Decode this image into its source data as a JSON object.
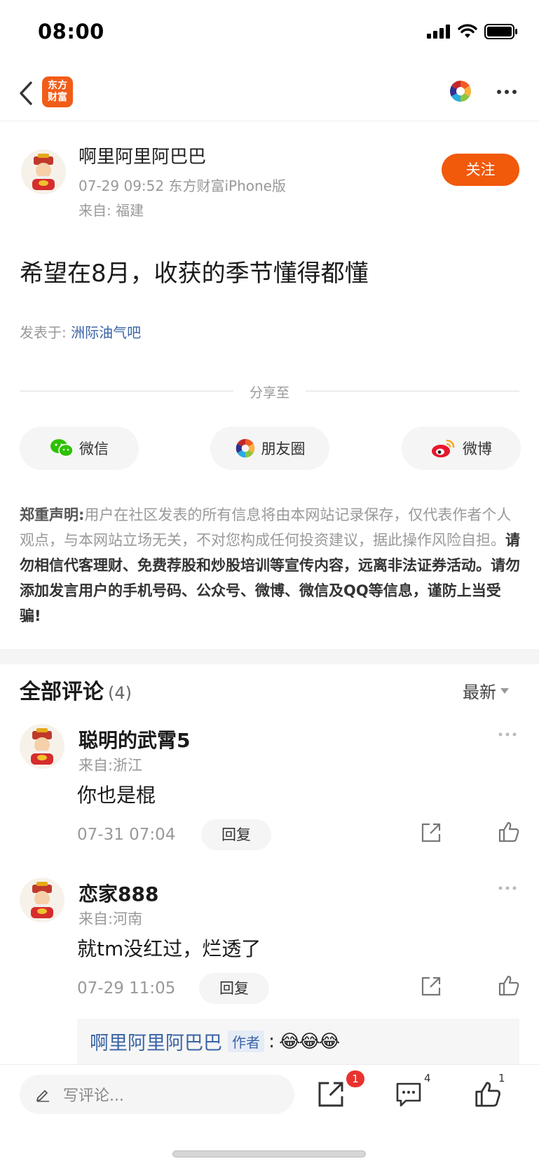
{
  "status_bar": {
    "time": "08:00"
  },
  "nav": {
    "logo_text": "东方财富"
  },
  "post": {
    "author": "啊里阿里阿巴巴",
    "meta": "07-29 09:52 东方财富iPhone版",
    "location": "来自: 福建",
    "follow_label": "关注",
    "title": "希望在8月，收获的季节懂得都懂",
    "posted_in_label": "发表于:",
    "bar_name": "洲际油气吧"
  },
  "share": {
    "label": "分享至",
    "wechat": "微信",
    "moments": "朋友圈",
    "weibo": "微博"
  },
  "disclaimer": {
    "heading": "郑重声明:",
    "body": "用户在社区发表的所有信息将由本网站记录保存，仅代表作者个人观点，与本网站立场无关，不对您构成任何投资建议，据此操作风险自担。",
    "warning": "请勿相信代客理财、免费荐股和炒股培训等宣传内容，远离非法证券活动。请勿添加发言用户的手机号码、公众号、微博、微信及QQ等信息，谨防上当受骗!"
  },
  "comments": {
    "title": "全部评论",
    "count": "(4)",
    "sort_label": "最新",
    "items": [
      {
        "name": "聪明的武霄5",
        "location": "来自:浙江",
        "text": "你也是棍",
        "time": "07-31 07:04",
        "reply_label": "回复"
      },
      {
        "name": "恋家888",
        "location": "来自:河南",
        "text": "就tm没红过，烂透了",
        "time": "07-29 11:05",
        "reply_label": "回复"
      }
    ],
    "author_reply": {
      "name": "啊里阿里阿巴巴",
      "badge": "作者",
      "colon": ":",
      "emoji": "😂😂😂"
    }
  },
  "bottom_bar": {
    "input_placeholder": "写评论...",
    "share_badge": "1",
    "comment_count": "4",
    "like_count": "1"
  },
  "colors": {
    "accent": "#f1590b",
    "link": "#3a64a6",
    "badge": "#e8332e"
  }
}
